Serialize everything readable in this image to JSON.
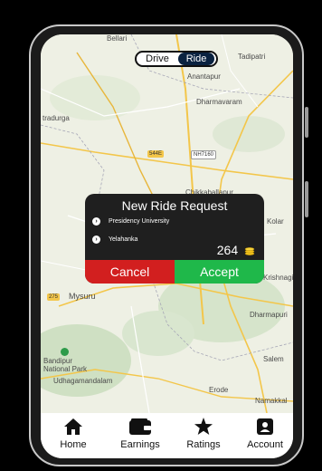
{
  "toggle": {
    "drive_label": "Drive",
    "ride_label": "Ride",
    "selected": "Ride"
  },
  "map": {
    "labels": {
      "tadipatri": "Tadipatri",
      "anantapur": "Anantapur",
      "dharmavaram": "Dharmavaram",
      "chitradurga": "tradurga",
      "chikkaballapur": "Chikkaballapur",
      "kolar": "Kolar",
      "krishnagiri": "Krishnagir",
      "mysuru": "Mysuru",
      "dharmapuri": "Dharmapuri",
      "bandipur": "Bandipur\nNational Park",
      "salem": "Salem",
      "udhagamandalam": "Udhagamandalam",
      "erode": "Erode",
      "namakkal": "Namakkal",
      "bellary": "Bellari"
    },
    "shields": {
      "nh544e": "544E",
      "nh160": "NH7160",
      "nh275": "275"
    }
  },
  "ride_request": {
    "title": "New Ride Request",
    "pickup": "Presidency University",
    "dropoff": "Yelahanka",
    "fare": "264",
    "fare_icon": "coins-icon",
    "cancel_label": "Cancel",
    "accept_label": "Accept",
    "colors": {
      "cancel": "#d21f1f",
      "accept": "#1fb84a",
      "card": "#1f1f1f"
    }
  },
  "nav": {
    "items": [
      {
        "label": "Home",
        "icon": "home-icon"
      },
      {
        "label": "Earnings",
        "icon": "wallet-icon"
      },
      {
        "label": "Ratings",
        "icon": "star-icon"
      },
      {
        "label": "Account",
        "icon": "account-icon"
      }
    ]
  }
}
